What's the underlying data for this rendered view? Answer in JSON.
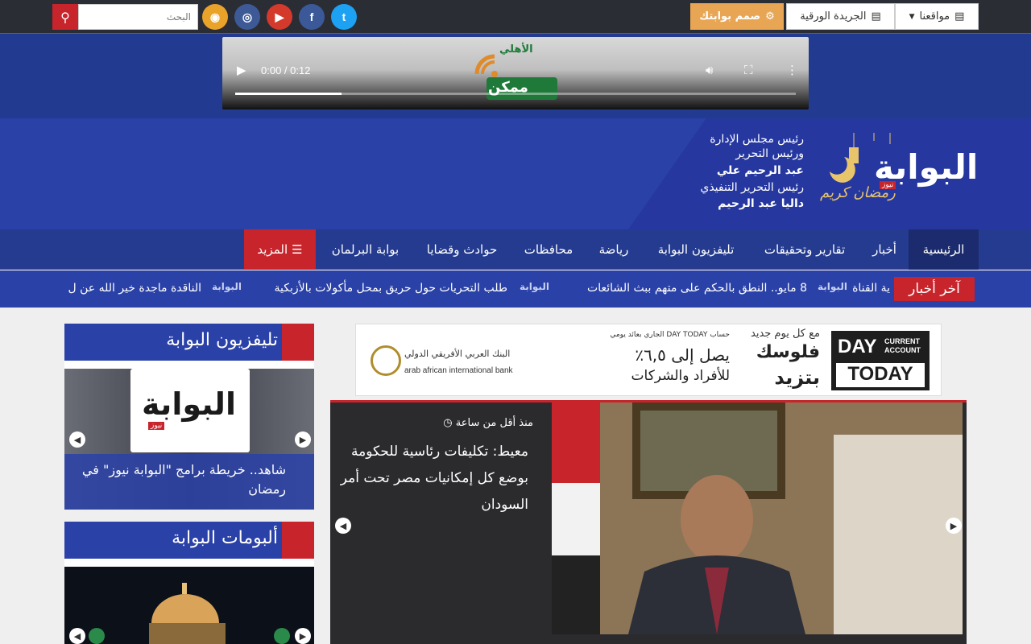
{
  "topbar": {
    "search_placeholder": "البحث",
    "menu_sites": "مواقعنا",
    "menu_paper": "الجريدة الورقية",
    "menu_design": "صمم بوابتك",
    "colors": {
      "bar": "#2b2d35",
      "search_button": "#c8242b",
      "design_button": "#e8a655"
    },
    "social": [
      {
        "name": "rss",
        "glyph": "◉",
        "color": "#e9a32b"
      },
      {
        "name": "instagram",
        "glyph": "◎",
        "color": "#3d5a96"
      },
      {
        "name": "youtube",
        "glyph": "▶",
        "color": "#d33a2c"
      },
      {
        "name": "facebook",
        "glyph": "f",
        "color": "#3b5998"
      },
      {
        "name": "twitter",
        "glyph": "t",
        "color": "#1da1f2"
      }
    ]
  },
  "video_ad": {
    "time": "0:00 / 0:12",
    "brand_text": "الأهلي",
    "brand_logo": "ممكن",
    "progress": 0.19
  },
  "header": {
    "logo": "البوابة",
    "logo_tag": "نيوز",
    "logo_caption": "رمضان كريم",
    "credit_line1": "رئيس مجلس الإدارة",
    "credit_line2": "ورئيس التحرير",
    "credit_line3": "عبد الرحيم علي",
    "credit_line4": "رئيس التحرير التنفيذي",
    "credit_line5": "داليا عبد الرحيم"
  },
  "nav": {
    "items": [
      "الرئيسية",
      "أخبار",
      "تقارير وتحقيقات",
      "تليفزيون البوابة",
      "رياضة",
      "محافظات",
      "حوادث وقضايا",
      "بوابة البرلمان"
    ],
    "more": "المزيد"
  },
  "ticker": {
    "label": "آخر أخبار",
    "brand": "البوابة",
    "items": [
      "ية القناة",
      "8 مايو.. النطق بالحكم على متهم ببث الشائعات",
      "طلب التحريات حول حريق بمحل مأكولات بالأزبكية",
      "الناقدة ماجدة خير الله عن ل"
    ]
  },
  "bank_ad": {
    "line1": "مع كل يوم جديد",
    "line2": "فلوسك",
    "line3": "بتزيد",
    "line4": "حساب DAY TODAY الجاري بعائد يومي",
    "line5": "يصل إلى ٦,٥٪",
    "line6": "للأفراد والشركات",
    "bank_ar": "البنك العربي الأفريقي الدولي",
    "bank_en": "arab african international bank",
    "day_top": "DAY",
    "current": "CURRENT",
    "account": "ACCOUNT",
    "day_bottom": "TODAY"
  },
  "slider": {
    "time": "منذ أقل من ساعة",
    "title": "معيط: تكليفات رئاسية للحكومة بوضع كل إمكانيات مصر تحت أمر السودان"
  },
  "sidebar": {
    "tv_title": "تليفزيون البوابة",
    "tv_caption": "شاهد.. خريطة برامج \"البوابة نيوز\" في رمضان",
    "tv_logo": "البوابة",
    "tv_logo_tag": "نيوز",
    "albums_title": "ألبومات البوابة"
  }
}
